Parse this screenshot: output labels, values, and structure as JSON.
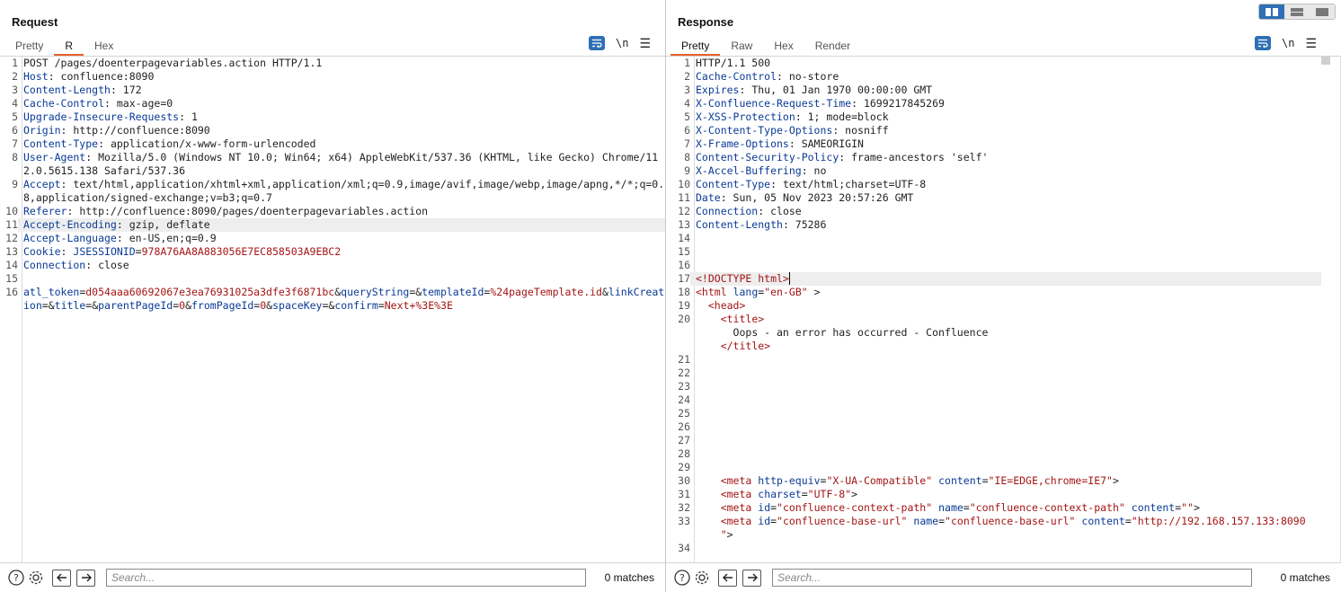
{
  "request": {
    "title": "Request",
    "tabs": [
      "Pretty",
      "R",
      "Hex"
    ],
    "active_tab": 1,
    "newline_label": "\\n",
    "search_placeholder": "Search...",
    "matches": "0 matches",
    "lines": [
      {
        "n": "1",
        "parts": [
          [
            "",
            "POST /pages/doenterpagevariables.action HTTP/1.1"
          ]
        ]
      },
      {
        "n": "2",
        "parts": [
          [
            "hk",
            "Host"
          ],
          [
            "",
            ": confluence:8090"
          ]
        ]
      },
      {
        "n": "3",
        "parts": [
          [
            "hk",
            "Content-Length"
          ],
          [
            "",
            ": 172"
          ]
        ]
      },
      {
        "n": "4",
        "parts": [
          [
            "hk",
            "Cache-Control"
          ],
          [
            "",
            ": max-age=0"
          ]
        ]
      },
      {
        "n": "5",
        "parts": [
          [
            "hk",
            "Upgrade-Insecure-Requests"
          ],
          [
            "",
            ": 1"
          ]
        ]
      },
      {
        "n": "6",
        "parts": [
          [
            "hk",
            "Origin"
          ],
          [
            "",
            ": http://confluence:8090"
          ]
        ]
      },
      {
        "n": "7",
        "parts": [
          [
            "hk",
            "Content-Type"
          ],
          [
            "",
            ": application/x-www-form-urlencoded"
          ]
        ]
      },
      {
        "n": "8",
        "parts": [
          [
            "hk",
            "User-Agent"
          ],
          [
            "",
            ": Mozilla/5.0 (Windows NT 10.0; Win64; x64) AppleWebKit/537.36 (KHTML, like Gecko) Chrome/112.0.5615.138 Safari/537.36"
          ]
        ]
      },
      {
        "n": "9",
        "parts": [
          [
            "hk",
            "Accept"
          ],
          [
            "",
            ": text/html,application/xhtml+xml,application/xml;q=0.9,image/avif,image/webp,image/apng,*/*;q=0.8,application/signed-exchange;v=b3;q=0.7"
          ]
        ]
      },
      {
        "n": "10",
        "parts": [
          [
            "hk",
            "Referer"
          ],
          [
            "",
            ": http://confluence:8090/pages/doenterpagevariables.action"
          ]
        ]
      },
      {
        "n": "11",
        "hl": true,
        "parts": [
          [
            "hk",
            "Accept-Encoding"
          ],
          [
            "",
            ": gzip, deflate"
          ]
        ]
      },
      {
        "n": "12",
        "parts": [
          [
            "hk",
            "Accept-Language"
          ],
          [
            "",
            ": en-US,en;q=0.9"
          ]
        ]
      },
      {
        "n": "13",
        "parts": [
          [
            "hk",
            "Cookie"
          ],
          [
            "",
            ": "
          ],
          [
            "hk",
            "JSESSIONID"
          ],
          [
            "",
            "="
          ],
          [
            "pv",
            "978A76AA8A883056E7EC858503A9EBC2"
          ]
        ]
      },
      {
        "n": "14",
        "parts": [
          [
            "hk",
            "Connection"
          ],
          [
            "",
            ": close"
          ]
        ]
      },
      {
        "n": "15",
        "parts": [
          [
            "",
            ""
          ]
        ]
      },
      {
        "n": "16",
        "parts": [
          [
            "hk",
            "atl_token"
          ],
          [
            "",
            "="
          ],
          [
            "pv",
            "d054aaa60692067e3ea76931025a3dfe3f6871bc"
          ],
          [
            "",
            "&"
          ],
          [
            "hk",
            "queryString"
          ],
          [
            "",
            "=&"
          ],
          [
            "hk",
            "templateId"
          ],
          [
            "",
            "="
          ],
          [
            "pv",
            "%24pageTemplate.id"
          ],
          [
            "",
            "&"
          ],
          [
            "hk",
            "linkCreation"
          ],
          [
            "",
            "=&"
          ],
          [
            "hk",
            "title"
          ],
          [
            "",
            "=&"
          ],
          [
            "hk",
            "parentPageId"
          ],
          [
            "",
            "="
          ],
          [
            "pv",
            "0"
          ],
          [
            "",
            "&"
          ],
          [
            "hk",
            "fromPageId"
          ],
          [
            "",
            "="
          ],
          [
            "pv",
            "0"
          ],
          [
            "",
            "&"
          ],
          [
            "hk",
            "spaceKey"
          ],
          [
            "",
            "=&"
          ],
          [
            "hk",
            "confirm"
          ],
          [
            "",
            "="
          ],
          [
            "pv",
            "Next+%3E%3E"
          ]
        ]
      }
    ]
  },
  "response": {
    "title": "Response",
    "tabs": [
      "Pretty",
      "Raw",
      "Hex",
      "Render"
    ],
    "active_tab": 0,
    "newline_label": "\\n",
    "search_placeholder": "Search...",
    "matches": "0 matches",
    "lines": [
      {
        "n": "1",
        "parts": [
          [
            "",
            "HTTP/1.1 500"
          ]
        ]
      },
      {
        "n": "2",
        "parts": [
          [
            "hk",
            "Cache-Control"
          ],
          [
            "",
            ": no-store"
          ]
        ]
      },
      {
        "n": "3",
        "parts": [
          [
            "hk",
            "Expires"
          ],
          [
            "",
            ": Thu, 01 Jan 1970 00:00:00 GMT"
          ]
        ]
      },
      {
        "n": "4",
        "parts": [
          [
            "hk",
            "X-Confluence-Request-Time"
          ],
          [
            "",
            ": 1699217845269"
          ]
        ]
      },
      {
        "n": "5",
        "parts": [
          [
            "hk",
            "X-XSS-Protection"
          ],
          [
            "",
            ": 1; mode=block"
          ]
        ]
      },
      {
        "n": "6",
        "parts": [
          [
            "hk",
            "X-Content-Type-Options"
          ],
          [
            "",
            ": nosniff"
          ]
        ]
      },
      {
        "n": "7",
        "parts": [
          [
            "hk",
            "X-Frame-Options"
          ],
          [
            "",
            ": SAMEORIGIN"
          ]
        ]
      },
      {
        "n": "8",
        "parts": [
          [
            "hk",
            "Content-Security-Policy"
          ],
          [
            "",
            ": frame-ancestors 'self'"
          ]
        ]
      },
      {
        "n": "9",
        "parts": [
          [
            "hk",
            "X-Accel-Buffering"
          ],
          [
            "",
            ": no"
          ]
        ]
      },
      {
        "n": "10",
        "parts": [
          [
            "hk",
            "Content-Type"
          ],
          [
            "",
            ": text/html;charset=UTF-8"
          ]
        ]
      },
      {
        "n": "11",
        "parts": [
          [
            "hk",
            "Date"
          ],
          [
            "",
            ": Sun, 05 Nov 2023 20:57:26 GMT"
          ]
        ]
      },
      {
        "n": "12",
        "parts": [
          [
            "hk",
            "Connection"
          ],
          [
            "",
            ": close"
          ]
        ]
      },
      {
        "n": "13",
        "parts": [
          [
            "hk",
            "Content-Length"
          ],
          [
            "",
            ": 75286"
          ]
        ]
      },
      {
        "n": "14",
        "parts": [
          [
            "",
            ""
          ]
        ]
      },
      {
        "n": "15",
        "parts": [
          [
            "",
            ""
          ]
        ]
      },
      {
        "n": "16",
        "parts": [
          [
            "",
            ""
          ]
        ]
      },
      {
        "n": "17",
        "hl": true,
        "cursor": true,
        "parts": [
          [
            "tg",
            "<!DOCTYPE html>"
          ]
        ]
      },
      {
        "n": "18",
        "parts": [
          [
            "tg",
            "<html"
          ],
          [
            "",
            " "
          ],
          [
            "at",
            "lang"
          ],
          [
            "",
            "="
          ],
          [
            "av",
            "\"en-GB\""
          ],
          [
            "",
            " >"
          ]
        ]
      },
      {
        "n": "19",
        "parts": [
          [
            "",
            "  "
          ],
          [
            "tg",
            "<head>"
          ]
        ]
      },
      {
        "n": "20",
        "parts": [
          [
            "",
            "    "
          ],
          [
            "tg",
            "<title>"
          ],
          [
            "",
            "\n      Oops - an error has occurred - Confluence\n    "
          ],
          [
            "tg",
            "</title>"
          ]
        ]
      },
      {
        "n": "21",
        "parts": [
          [
            "",
            ""
          ]
        ]
      },
      {
        "n": "22",
        "parts": [
          [
            "",
            ""
          ]
        ]
      },
      {
        "n": "23",
        "parts": [
          [
            "",
            ""
          ]
        ]
      },
      {
        "n": "24",
        "parts": [
          [
            "",
            ""
          ]
        ]
      },
      {
        "n": "25",
        "parts": [
          [
            "",
            ""
          ]
        ]
      },
      {
        "n": "26",
        "parts": [
          [
            "",
            ""
          ]
        ]
      },
      {
        "n": "27",
        "parts": [
          [
            "",
            ""
          ]
        ]
      },
      {
        "n": "28",
        "parts": [
          [
            "",
            ""
          ]
        ]
      },
      {
        "n": "29",
        "parts": [
          [
            "",
            ""
          ]
        ]
      },
      {
        "n": "30",
        "parts": [
          [
            "",
            "    "
          ],
          [
            "tg",
            "<meta"
          ],
          [
            "",
            " "
          ],
          [
            "at",
            "http-equiv"
          ],
          [
            "",
            "="
          ],
          [
            "av",
            "\"X-UA-Compatible\""
          ],
          [
            "",
            " "
          ],
          [
            "at",
            "content"
          ],
          [
            "",
            "="
          ],
          [
            "av",
            "\"IE=EDGE,chrome=IE7\""
          ],
          [
            "",
            ">"
          ]
        ]
      },
      {
        "n": "31",
        "parts": [
          [
            "",
            "    "
          ],
          [
            "tg",
            "<meta"
          ],
          [
            "",
            " "
          ],
          [
            "at",
            "charset"
          ],
          [
            "",
            "="
          ],
          [
            "av",
            "\"UTF-8\""
          ],
          [
            "",
            ">"
          ]
        ]
      },
      {
        "n": "32",
        "parts": [
          [
            "",
            "    "
          ],
          [
            "tg",
            "<meta"
          ],
          [
            "",
            " "
          ],
          [
            "at",
            "id"
          ],
          [
            "",
            "="
          ],
          [
            "av",
            "\"confluence-context-path\""
          ],
          [
            "",
            " "
          ],
          [
            "at",
            "name"
          ],
          [
            "",
            "="
          ],
          [
            "av",
            "\"confluence-context-path\""
          ],
          [
            "",
            " "
          ],
          [
            "at",
            "content"
          ],
          [
            "",
            "="
          ],
          [
            "av",
            "\"\""
          ],
          [
            "",
            ">"
          ]
        ]
      },
      {
        "n": "33",
        "parts": [
          [
            "",
            "    "
          ],
          [
            "tg",
            "<meta"
          ],
          [
            "",
            " "
          ],
          [
            "at",
            "id"
          ],
          [
            "",
            "="
          ],
          [
            "av",
            "\"confluence-base-url\""
          ],
          [
            "",
            " "
          ],
          [
            "at",
            "name"
          ],
          [
            "",
            "="
          ],
          [
            "av",
            "\"confluence-base-url\""
          ],
          [
            "",
            " "
          ],
          [
            "at",
            "content"
          ],
          [
            "",
            "="
          ],
          [
            "av",
            "\"http://192.168.157.133:8090\n    \""
          ],
          [
            "",
            ">"
          ]
        ]
      },
      {
        "n": "34",
        "parts": [
          [
            "",
            ""
          ]
        ]
      }
    ]
  },
  "icons": {
    "wrap": "text-wrap-icon",
    "menu": "hamburger-menu-icon",
    "help": "help-icon",
    "settings": "gear-icon",
    "back": "arrow-left-icon",
    "forward": "arrow-right-icon"
  },
  "colors": {
    "accent": "#e8602c",
    "header_key": "#0a3a96",
    "param_value": "#a31515",
    "button_blue": "#2f6fb5"
  }
}
